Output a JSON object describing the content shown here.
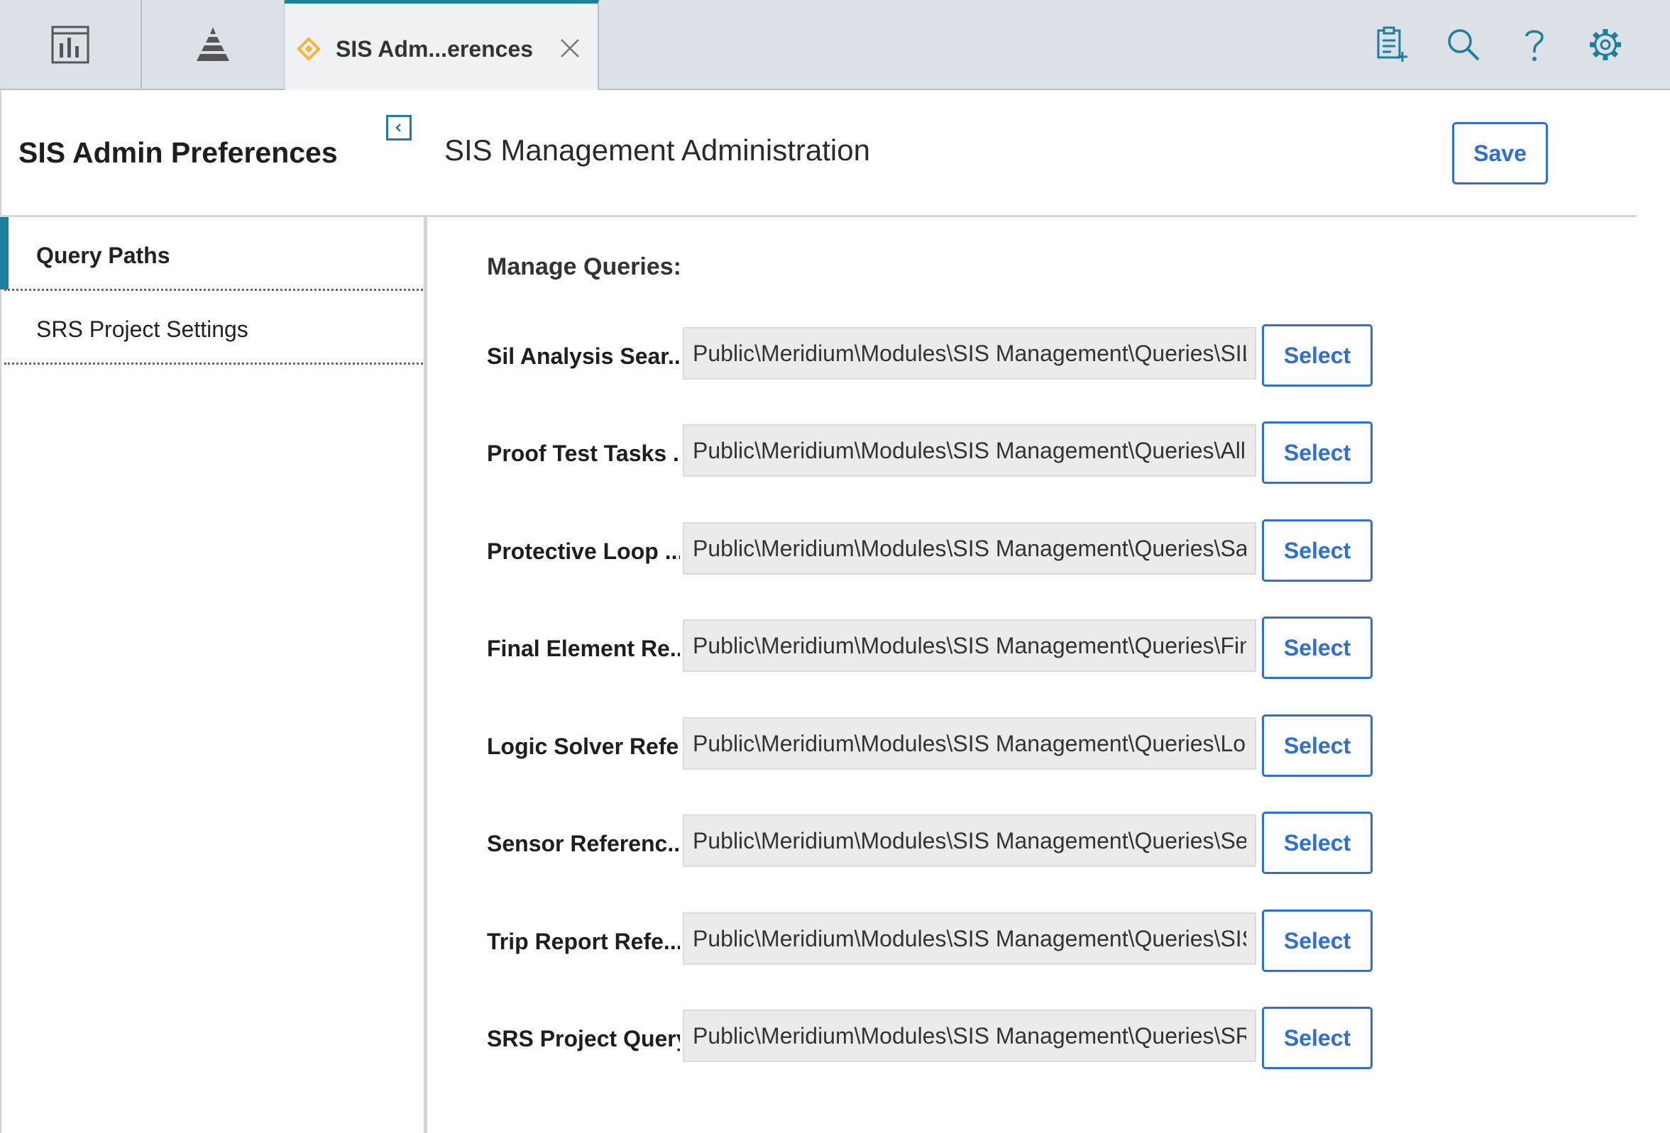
{
  "topbar": {
    "tabs": [
      {
        "label": "SIS Adm...erences",
        "icon": "diamond-icon",
        "color": "#f0b93a"
      }
    ],
    "icons": [
      "dashboard-icon",
      "hierarchy-icon",
      "new-report-icon",
      "search-icon",
      "help-icon",
      "gear-icon"
    ]
  },
  "header": {
    "sidebar_title": "SIS Admin Preferences",
    "main_title": "SIS Management Administration",
    "save_label": "Save"
  },
  "sidebar": {
    "items": [
      {
        "label": "Query Paths",
        "active": true
      },
      {
        "label": "SRS Project Settings",
        "active": false
      }
    ]
  },
  "main": {
    "heading": "Manage Queries:",
    "select_label": "Select",
    "rows": [
      {
        "label": "Sil Analysis Sear...",
        "path": "Public\\Meridium\\Modules\\SIS Management\\Queries\\SIL..."
      },
      {
        "label": "Proof Test Tasks ...",
        "path": "Public\\Meridium\\Modules\\SIS Management\\Queries\\All ..."
      },
      {
        "label": "Protective Loop ...",
        "path": "Public\\Meridium\\Modules\\SIS Management\\Queries\\Saf..."
      },
      {
        "label": "Final Element Re...",
        "path": "Public\\Meridium\\Modules\\SIS Management\\Queries\\Fin..."
      },
      {
        "label": "Logic Solver Refe...",
        "path": "Public\\Meridium\\Modules\\SIS Management\\Queries\\Log..."
      },
      {
        "label": "Sensor Referenc...",
        "path": "Public\\Meridium\\Modules\\SIS Management\\Queries\\Se..."
      },
      {
        "label": "Trip Report Refe...",
        "path": "Public\\Meridium\\Modules\\SIS Management\\Queries\\SIS..."
      },
      {
        "label": "SRS Project Query",
        "path": "Public\\Meridium\\Modules\\SIS Management\\Queries\\SR..."
      }
    ]
  },
  "colors": {
    "accent": "#1b7f9e",
    "button": "#2f6fd1",
    "tab_icon": "#f0b93a",
    "topbar_bg": "#dbe1e6"
  }
}
